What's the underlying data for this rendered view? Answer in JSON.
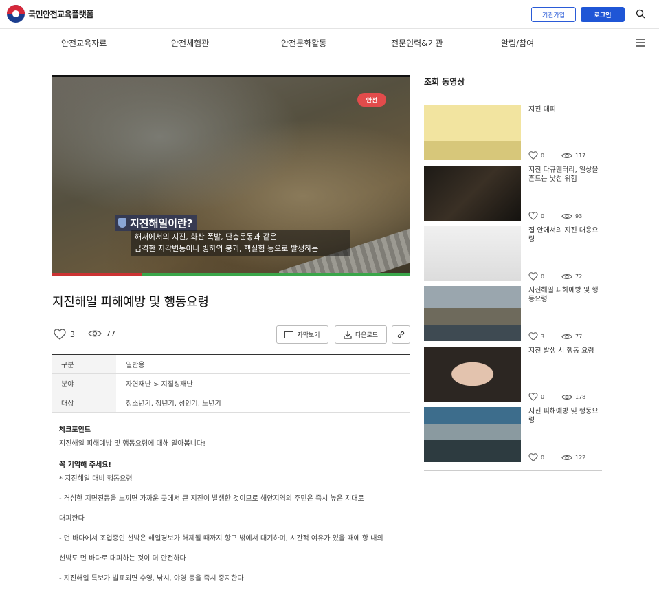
{
  "header": {
    "logo_text": "국민안전교육플랫폼",
    "org_join_label": "기관가입",
    "login_label": "로그인"
  },
  "nav": {
    "items": [
      "안전교육자료",
      "안전체험관",
      "안전문화활동",
      "전문인력&기관",
      "알림/참여"
    ]
  },
  "video": {
    "caption_title": "지진해일이란?",
    "caption_line1": "해저에서의 지진, 화산 폭발, 단층운동과 같은",
    "caption_line2": "급격한 지각변동이나 빙하의 붕괴, 핵실험 등으로 발생하는",
    "badge": "안전"
  },
  "content": {
    "title": "지진해일 피해예방 및 행동요령",
    "likes": "3",
    "views": "77",
    "subtitle_button": "자막보기",
    "download_button": "다운로드"
  },
  "info": [
    {
      "key": "구분",
      "value": "일반용"
    },
    {
      "key": "분야",
      "value": "자연재난 > 지질성재난"
    },
    {
      "key": "대상",
      "value": "청소년기, 청년기, 성인기, 노년기"
    }
  ],
  "body": {
    "checkpoint_heading": "체크포인트",
    "checkpoint_text": "지진해일 피해예방 및 행동요령에 대해 알아봅니다!",
    "remember_heading": "꼭 기억해 주세요!",
    "lines": [
      "* 지진해일 대비 행동요령",
      "- 격심한 지면진동을 느끼면 가까운 곳에서 큰 지진이 발생한 것이므로 해안지역의 주민은 즉시 높은 지대로",
      "대피한다",
      "- 먼 바다에서 조업중인 선박은 해일경보가 해제될 때까지 항구 밖에서 대기하며, 시간적 여유가 있을 때에 항 내의",
      "선박도 먼 바다로 대피하는 것이 더 안전하다",
      "- 지진해일 특보가 발표되면 수영, 낚시, 야영 등을 즉시 중지한다"
    ]
  },
  "sidebar": {
    "title": "조회 동영상",
    "videos": [
      {
        "title": "지진 대피",
        "likes": "0",
        "views": "117"
      },
      {
        "title": "지진 다큐멘터리, 일상을 흔드는 낯선 위험",
        "likes": "0",
        "views": "93"
      },
      {
        "title": "집 안에서의 지진 대응요령",
        "likes": "0",
        "views": "72"
      },
      {
        "title": "지진해일 피해예방 및 행동요령",
        "likes": "3",
        "views": "77"
      },
      {
        "title": "지진 발생 시 행동 요령",
        "likes": "0",
        "views": "178"
      },
      {
        "title": "지진 피해예방 및 행동요령",
        "likes": "0",
        "views": "122"
      }
    ]
  }
}
